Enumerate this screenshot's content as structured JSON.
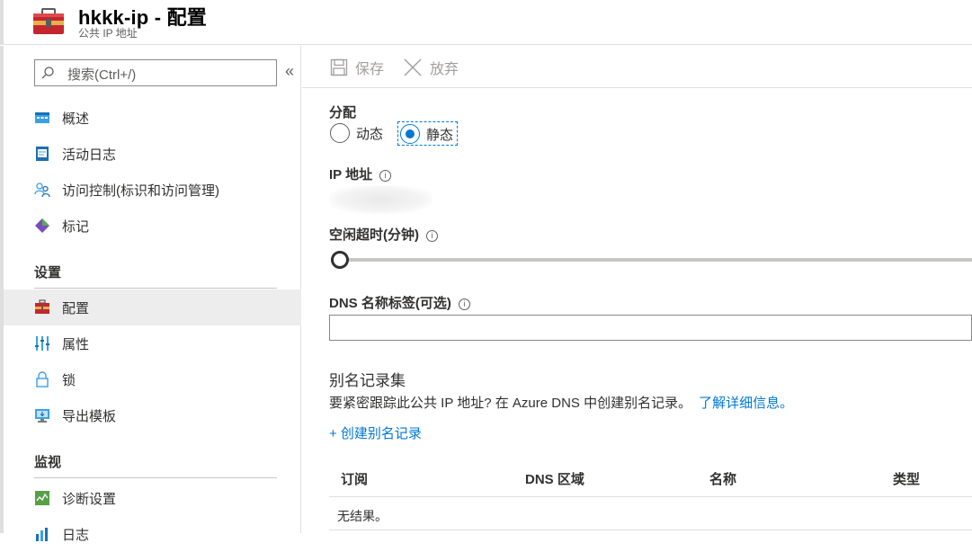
{
  "header": {
    "title": "hkkk-ip - 配置",
    "subtitle": "公共 IP 地址",
    "icon": "toolbox-icon"
  },
  "sidebar": {
    "search_placeholder": "搜索(Ctrl+/)",
    "collapse_label": "«",
    "items_top": [
      {
        "label": "概述",
        "icon": "overview-icon"
      },
      {
        "label": "活动日志",
        "icon": "activity-log-icon"
      },
      {
        "label": "访问控制(标识和访问管理)",
        "icon": "people-icon"
      },
      {
        "label": "标记",
        "icon": "tag-icon"
      }
    ],
    "section_settings": "设置",
    "items_settings": [
      {
        "label": "配置",
        "icon": "toolbox-icon",
        "active": true
      },
      {
        "label": "属性",
        "icon": "properties-icon"
      },
      {
        "label": "锁",
        "icon": "lock-icon"
      },
      {
        "label": "导出模板",
        "icon": "export-template-icon"
      }
    ],
    "section_monitor": "监视",
    "items_monitor": [
      {
        "label": "诊断设置",
        "icon": "diagnostics-icon"
      },
      {
        "label": "日志",
        "icon": "logs-icon"
      }
    ]
  },
  "toolbar": {
    "save_label": "保存",
    "discard_label": "放弃"
  },
  "form": {
    "assignment_label": "分配",
    "assignment_options": [
      {
        "label": "动态",
        "selected": false
      },
      {
        "label": "静态",
        "selected": true
      }
    ],
    "ip_label": "IP 地址",
    "idle_timeout_label": "空闲超时(分钟)",
    "idle_timeout_value": 4,
    "dns_label": "DNS 名称标签(可选)",
    "dns_value": ""
  },
  "alias": {
    "title": "别名记录集",
    "description": "要紧密跟踪此公共 IP 地址? 在 Azure DNS 中创建别名记录。",
    "learn_more": "了解详细信息。",
    "create_label": "+ 创建别名记录",
    "columns": [
      "订阅",
      "DNS 区域",
      "名称",
      "类型"
    ],
    "empty_text": "无结果。"
  },
  "colors": {
    "accent": "#0078d4",
    "active_bg": "#ededed",
    "toolbox_red": "#c4262e"
  }
}
